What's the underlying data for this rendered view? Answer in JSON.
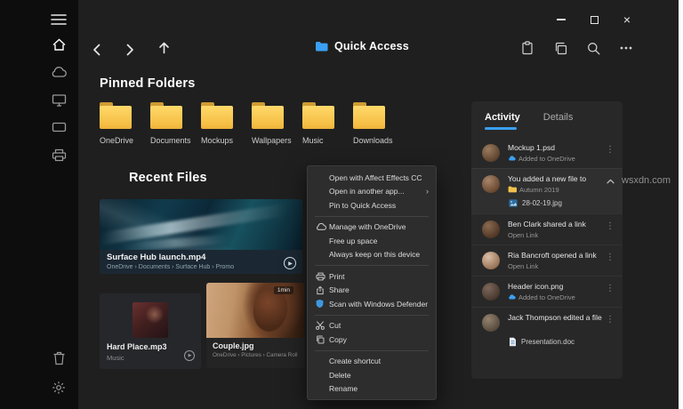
{
  "colors": {
    "accent": "#3aa0f3",
    "folder_yellow": "#f6bf45",
    "defender_blue": "#3f97e0"
  },
  "icons": {
    "more_vertical": "⋮",
    "play": "▶",
    "submenu_chevron": "›"
  },
  "window": {
    "watermark": "wsxdn.com"
  },
  "toolbar": {
    "title": "Quick Access"
  },
  "pinned": {
    "heading": "Pinned Folders",
    "folders": [
      {
        "name": "OneDrive"
      },
      {
        "name": "Documents"
      },
      {
        "name": "Mockups"
      },
      {
        "name": "Wallpapers"
      },
      {
        "name": "Music"
      },
      {
        "name": "Downloads"
      }
    ]
  },
  "recent": {
    "heading": "Recent Files",
    "video": {
      "title": "Surface Hub launch.mp4",
      "path": "OneDrive › Documents › Surface Hub › Promo"
    },
    "audio": {
      "title": "Hard Place.mp3",
      "path": "Music"
    },
    "photo": {
      "title": "Couple.jpg",
      "path": "OneDrive › Pictures › Camera Roll",
      "badge": "1min"
    }
  },
  "context_menu": {
    "groups": [
      {
        "items": [
          {
            "label": "Open with Affect Effects CC"
          },
          {
            "label": "Open in another app..."
          },
          {
            "label": "Pin to Quick Access"
          }
        ]
      },
      {
        "items": [
          {
            "label": "Manage with OneDrive"
          },
          {
            "label": "Free up space"
          },
          {
            "label": "Always keep on this device"
          }
        ]
      },
      {
        "items": [
          {
            "label": "Print"
          },
          {
            "label": "Share"
          },
          {
            "label": "Scan with Windows Defender"
          }
        ]
      },
      {
        "items": [
          {
            "label": "Cut"
          },
          {
            "label": "Copy"
          }
        ]
      },
      {
        "items": [
          {
            "label": "Create shortcut"
          },
          {
            "label": "Delete"
          },
          {
            "label": "Rename"
          }
        ]
      }
    ]
  },
  "activity": {
    "tabs": [
      {
        "label": "Activity"
      },
      {
        "label": "Details"
      }
    ],
    "items": [
      {
        "title": "Mockup 1.psd",
        "subtitle": "Added to OneDrive"
      },
      {
        "title": "You added a new file to",
        "subtitle": "Autumn 2019",
        "attachment": "28-02-19.jpg"
      },
      {
        "title": "Ben Clark shared a link",
        "subtitle": "Open Link"
      },
      {
        "title": "Ria Bancroft opened a link",
        "subtitle": "Open Link"
      },
      {
        "title": "Header icon.png",
        "subtitle": "Added to OneDrive"
      },
      {
        "title": "Jack Thompson edited a file",
        "attachment": "Presentation.doc"
      }
    ]
  }
}
